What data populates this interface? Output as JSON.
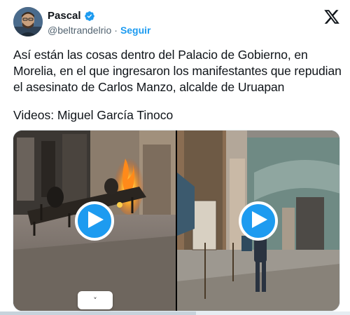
{
  "author": {
    "name": "Pascal",
    "handle": "@beltrandelrio",
    "separator": "·",
    "follow_label": "Seguir",
    "verified": true
  },
  "tweet": {
    "text": "Así están las cosas dentro del Palacio de Gobierno, en Morelia, en el que ingresaron los manifestantes que repudian el asesinato de Carlos Manzo, alcalde de Uruapan",
    "credit": "Videos: Miguel García Tinoco"
  },
  "media": {
    "videos": [
      {
        "icon": "play-icon"
      },
      {
        "icon": "play-icon"
      }
    ],
    "expand_label": "˅"
  },
  "colors": {
    "accent": "#1d9bf0",
    "text": "#0f1419",
    "muted": "#536471"
  }
}
